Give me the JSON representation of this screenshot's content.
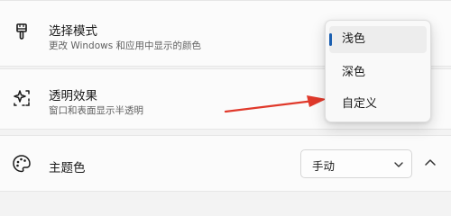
{
  "colors": {
    "accent": "#1b5fb0",
    "annotation_arrow": "#e0392b"
  },
  "settings": {
    "mode": {
      "title": "选择模式",
      "subtitle": "更改 Windows 和应用中显示的颜色",
      "icon": "paintbrush-icon"
    },
    "transparency": {
      "title": "透明效果",
      "subtitle": "窗口和表面显示半透明",
      "icon": "sparkle-icon"
    },
    "accent": {
      "title": "主题色",
      "icon": "palette-icon",
      "select_value": "手动"
    }
  },
  "dropdown": {
    "options": [
      {
        "label": "浅色",
        "selected": true
      },
      {
        "label": "深色",
        "selected": false
      },
      {
        "label": "自定义",
        "selected": false
      }
    ]
  }
}
